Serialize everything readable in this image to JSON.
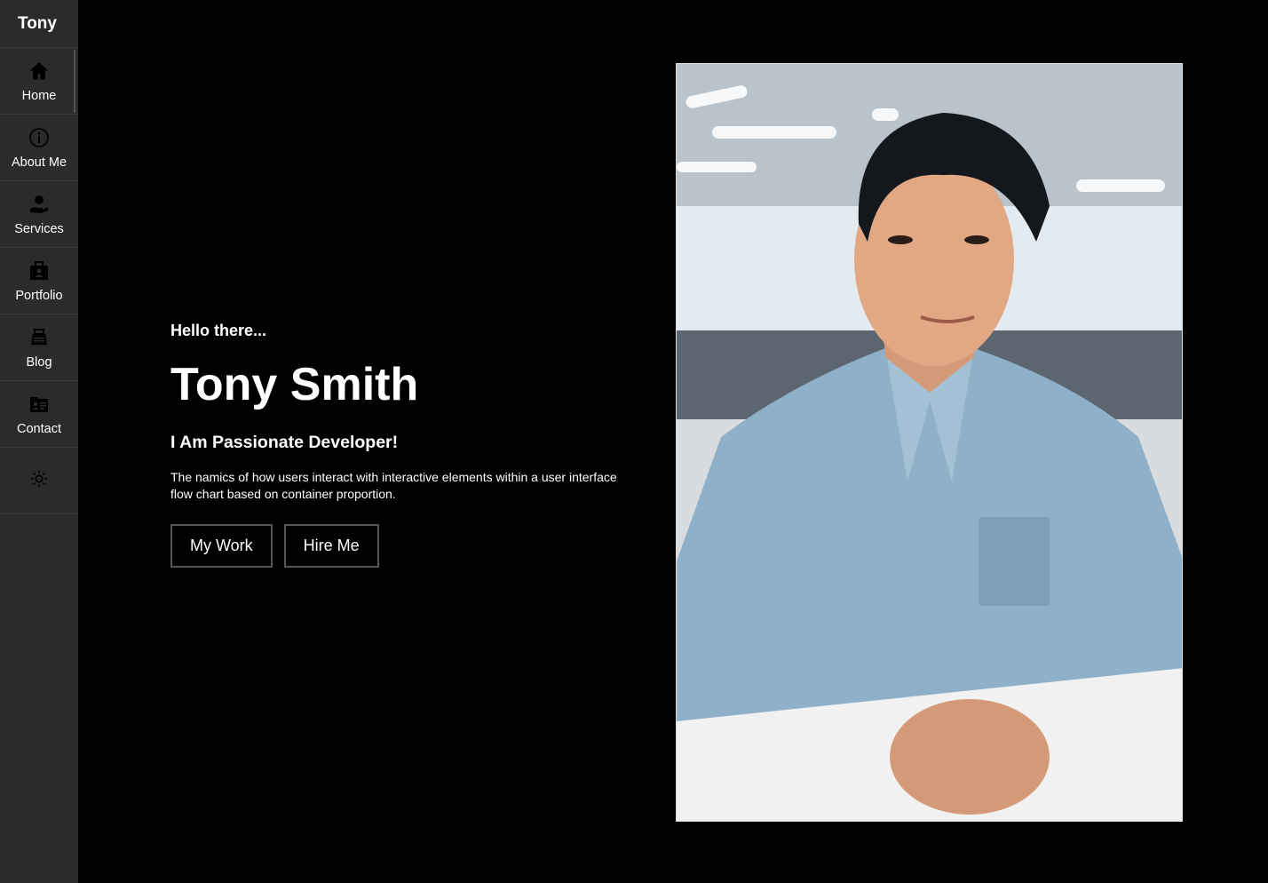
{
  "sidebar": {
    "brand": "Tony",
    "items": [
      {
        "label": "Home",
        "icon": "home-icon"
      },
      {
        "label": "About Me",
        "icon": "info-icon"
      },
      {
        "label": "Services",
        "icon": "services-icon"
      },
      {
        "label": "Portfolio",
        "icon": "portfolio-icon"
      },
      {
        "label": "Blog",
        "icon": "blog-icon"
      },
      {
        "label": "Contact",
        "icon": "contact-icon"
      }
    ],
    "theme_toggle_icon": "sun-icon"
  },
  "hero": {
    "greeting": "Hello there...",
    "name": "Tony Smith",
    "tagline": "I Am Passionate Developer!",
    "description": "The namics of how users interact with interactive elements within a user interface flow chart based on container proportion.",
    "buttons": {
      "my_work": "My Work",
      "hire_me": "Hire Me"
    }
  },
  "colors": {
    "background": "#000000",
    "sidebar": "#2b2b2b",
    "text": "#ffffff",
    "button_border": "#555555"
  }
}
